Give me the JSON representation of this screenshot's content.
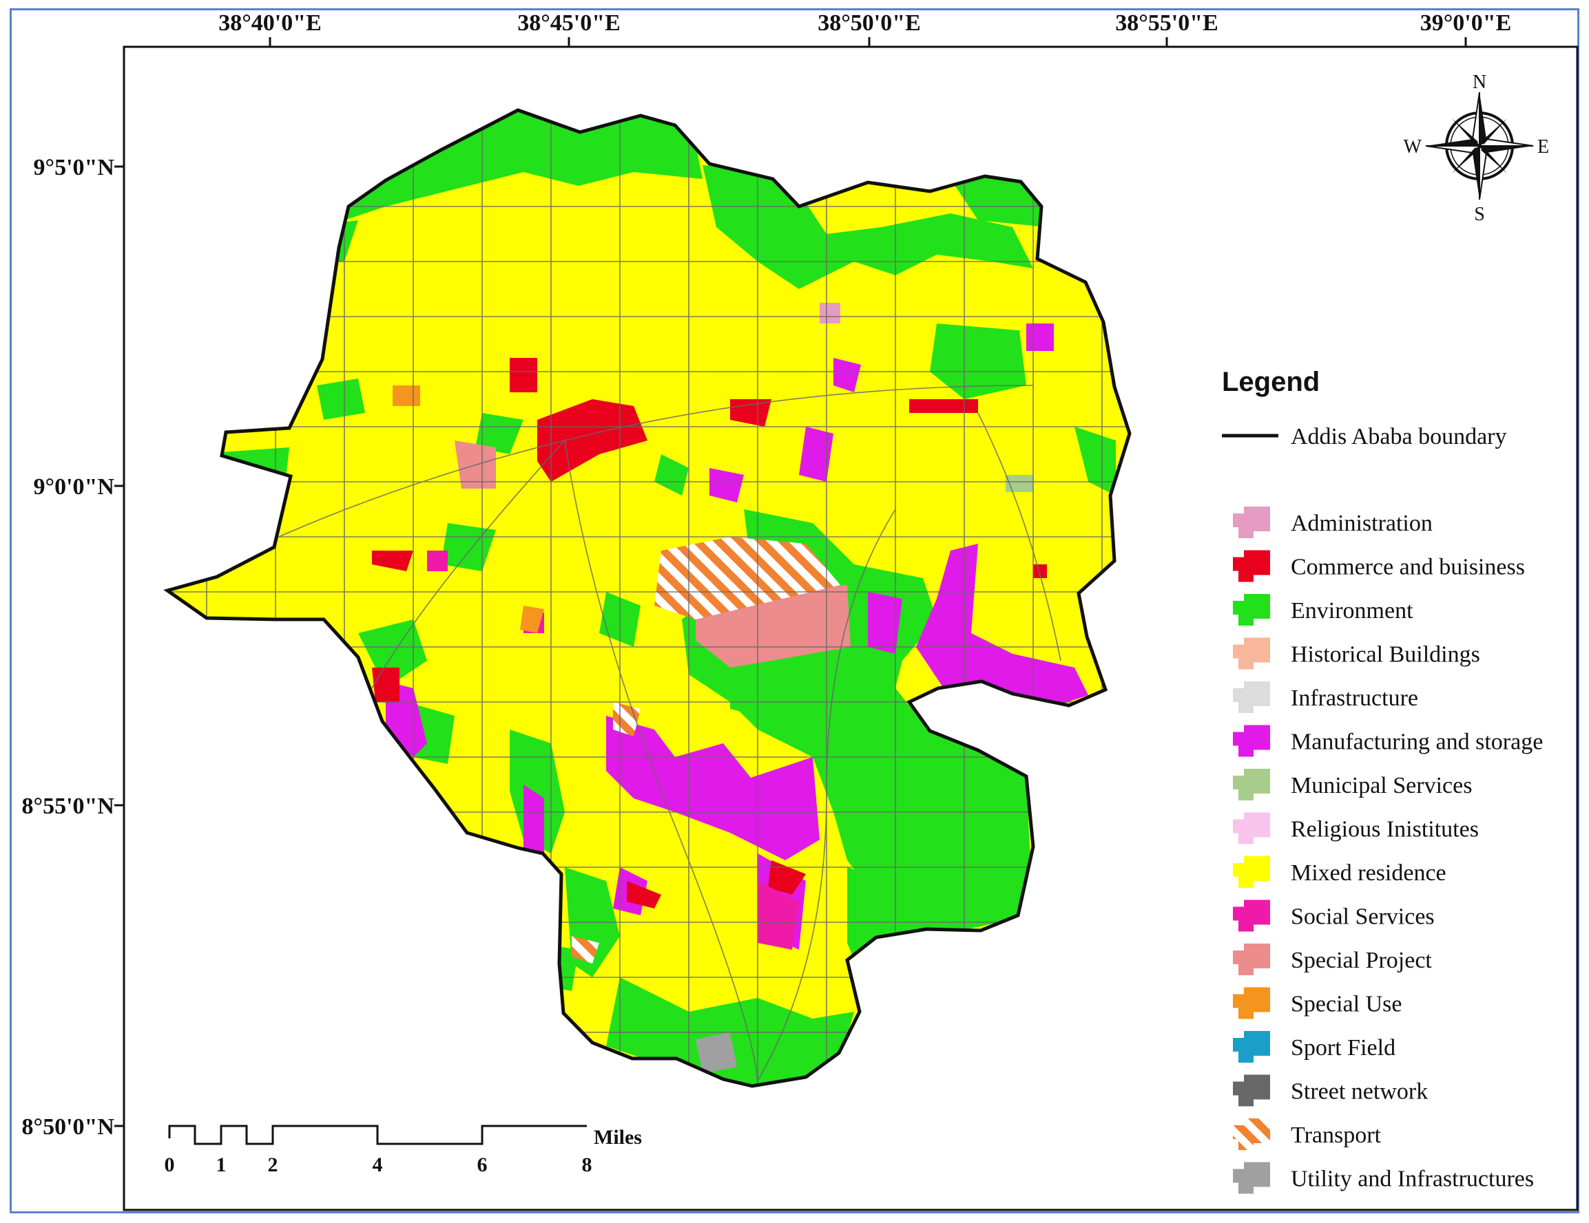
{
  "map": {
    "top_coords": [
      "38°40'0\"E",
      "38°45'0\"E",
      "38°50'0\"E",
      "38°55'0\"E",
      "39°0'0\"E"
    ],
    "left_coords": [
      "9°5'0\"N",
      "9°0'0\"N",
      "8°55'0\"N",
      "8°50'0\"N"
    ]
  },
  "compass": {
    "n": "N",
    "s": "S",
    "e": "E",
    "w": "W"
  },
  "legend": {
    "title": "Legend",
    "boundary_label": "Addis Ababa boundary",
    "items": [
      {
        "label": "Administration",
        "color": "#e59cc2"
      },
      {
        "label": "Commerce and buisiness",
        "color": "#e8001c"
      },
      {
        "label": "Environment",
        "color": "#22e01a"
      },
      {
        "label": "Historical Buildings",
        "color": "#f8b69a"
      },
      {
        "label": "Infrastructure",
        "color": "#dcdcdc"
      },
      {
        "label": "Manufacturing and storage",
        "color": "#e01ae8"
      },
      {
        "label": "Municipal Services",
        "color": "#a8cc8c"
      },
      {
        "label": "Religious Inistitutes",
        "color": "#f8c3ec"
      },
      {
        "label": "Mixed residence",
        "color": "#ffff00"
      },
      {
        "label": "Social Services",
        "color": "#f01aa8"
      },
      {
        "label": "Special Project",
        "color": "#ec8c8c"
      },
      {
        "label": "Special Use",
        "color": "#f5941e"
      },
      {
        "label": "Sport Field",
        "color": "#1aa0c8"
      },
      {
        "label": "Street network",
        "color": "#686868"
      },
      {
        "label": "Transport",
        "color": "#f08232"
      },
      {
        "label": "Utility and Infrastructures",
        "color": "#a0a0a0"
      }
    ]
  },
  "scale": {
    "ticks": [
      "0",
      "1",
      "2",
      "4",
      "6",
      "8"
    ],
    "unit": "Miles"
  }
}
